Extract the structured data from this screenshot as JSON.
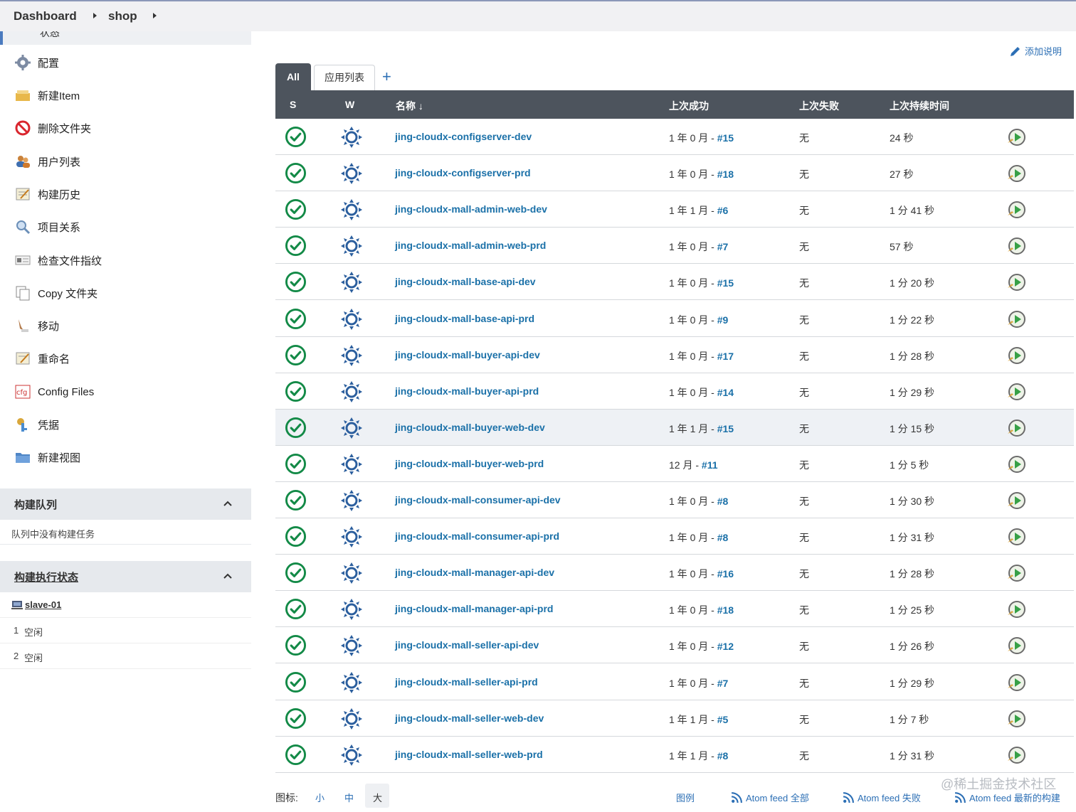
{
  "breadcrumb": {
    "dashboard": "Dashboard",
    "shop": "shop"
  },
  "sidebar": {
    "top_stub": "状态",
    "items": [
      {
        "label": "配置",
        "icon": "gear-icon"
      },
      {
        "label": "新建Item",
        "icon": "new-item-icon"
      },
      {
        "label": "删除文件夹",
        "icon": "delete-icon"
      },
      {
        "label": "用户列表",
        "icon": "users-icon"
      },
      {
        "label": "构建历史",
        "icon": "notepad-icon"
      },
      {
        "label": "项目关系",
        "icon": "search-icon"
      },
      {
        "label": "检查文件指纹",
        "icon": "fingerprint-icon"
      },
      {
        "label": "Copy 文件夹",
        "icon": "copy-icon"
      },
      {
        "label": "移动",
        "icon": "move-icon"
      },
      {
        "label": "重命名",
        "icon": "rename-icon"
      },
      {
        "label": "Config Files",
        "icon": "cfg-icon"
      },
      {
        "label": "凭据",
        "icon": "credentials-icon"
      },
      {
        "label": "新建视图",
        "icon": "folder-icon"
      }
    ],
    "queue": {
      "title": "构建队列",
      "empty_text": "队列中没有构建任务"
    },
    "executors": {
      "title": "构建执行状态",
      "node": "slave-01",
      "rows": [
        {
          "num": "1",
          "state": "空闲"
        },
        {
          "num": "2",
          "state": "空闲"
        }
      ]
    }
  },
  "main": {
    "add_description": "添加说明",
    "tabs": {
      "all": "All",
      "apps": "应用列表",
      "add": "+"
    },
    "columns": {
      "s": "S",
      "w": "W",
      "name": "名称 ↓",
      "last_success": "上次成功",
      "last_failure": "上次失败",
      "last_duration": "上次持续时间"
    },
    "jobs": [
      {
        "name": "jing-cloudx-configserver-dev",
        "success": "1 年 0 月 - ",
        "build": "#15",
        "failure": "无",
        "duration": "24 秒"
      },
      {
        "name": "jing-cloudx-configserver-prd",
        "success": "1 年 0 月 - ",
        "build": "#18",
        "failure": "无",
        "duration": "27 秒"
      },
      {
        "name": "jing-cloudx-mall-admin-web-dev",
        "success": "1 年 1 月 - ",
        "build": "#6",
        "failure": "无",
        "duration": "1 分 41 秒"
      },
      {
        "name": "jing-cloudx-mall-admin-web-prd",
        "success": "1 年 0 月 - ",
        "build": "#7",
        "failure": "无",
        "duration": "57 秒"
      },
      {
        "name": "jing-cloudx-mall-base-api-dev",
        "success": "1 年 0 月 - ",
        "build": "#15",
        "failure": "无",
        "duration": "1 分 20 秒"
      },
      {
        "name": "jing-cloudx-mall-base-api-prd",
        "success": "1 年 0 月 - ",
        "build": "#9",
        "failure": "无",
        "duration": "1 分 22 秒"
      },
      {
        "name": "jing-cloudx-mall-buyer-api-dev",
        "success": "1 年 0 月 - ",
        "build": "#17",
        "failure": "无",
        "duration": "1 分 28 秒"
      },
      {
        "name": "jing-cloudx-mall-buyer-api-prd",
        "success": "1 年 0 月 - ",
        "build": "#14",
        "failure": "无",
        "duration": "1 分 29 秒"
      },
      {
        "name": "jing-cloudx-mall-buyer-web-dev",
        "success": "1 年 1 月 - ",
        "build": "#15",
        "failure": "无",
        "duration": "1 分 15 秒"
      },
      {
        "name": "jing-cloudx-mall-buyer-web-prd",
        "success": "12 月 - ",
        "build": "#11",
        "failure": "无",
        "duration": "1 分 5 秒"
      },
      {
        "name": "jing-cloudx-mall-consumer-api-dev",
        "success": "1 年 0 月 - ",
        "build": "#8",
        "failure": "无",
        "duration": "1 分 30 秒"
      },
      {
        "name": "jing-cloudx-mall-consumer-api-prd",
        "success": "1 年 0 月 - ",
        "build": "#8",
        "failure": "无",
        "duration": "1 分 31 秒"
      },
      {
        "name": "jing-cloudx-mall-manager-api-dev",
        "success": "1 年 0 月 - ",
        "build": "#16",
        "failure": "无",
        "duration": "1 分 28 秒"
      },
      {
        "name": "jing-cloudx-mall-manager-api-prd",
        "success": "1 年 0 月 - ",
        "build": "#18",
        "failure": "无",
        "duration": "1 分 25 秒"
      },
      {
        "name": "jing-cloudx-mall-seller-api-dev",
        "success": "1 年 0 月 - ",
        "build": "#12",
        "failure": "无",
        "duration": "1 分 26 秒"
      },
      {
        "name": "jing-cloudx-mall-seller-api-prd",
        "success": "1 年 0 月 - ",
        "build": "#7",
        "failure": "无",
        "duration": "1 分 29 秒"
      },
      {
        "name": "jing-cloudx-mall-seller-web-dev",
        "success": "1 年 1 月 - ",
        "build": "#5",
        "failure": "无",
        "duration": "1 分 7 秒"
      },
      {
        "name": "jing-cloudx-mall-seller-web-prd",
        "success": "1 年 1 月 - ",
        "build": "#8",
        "failure": "无",
        "duration": "1 分 31 秒"
      }
    ],
    "footer": {
      "icon_label": "图标:",
      "sizes": [
        "小",
        "中",
        "大"
      ],
      "legend": "图例",
      "feed_all": "Atom feed 全部",
      "feed_fail": "Atom feed 失败",
      "feed_latest": "Atom feed 最新的构建"
    }
  },
  "watermark": "@稀土掘金技术社区",
  "colors": {
    "header_bg": "#4d545d",
    "link": "#1a70a8",
    "success_green": "#138a47"
  }
}
